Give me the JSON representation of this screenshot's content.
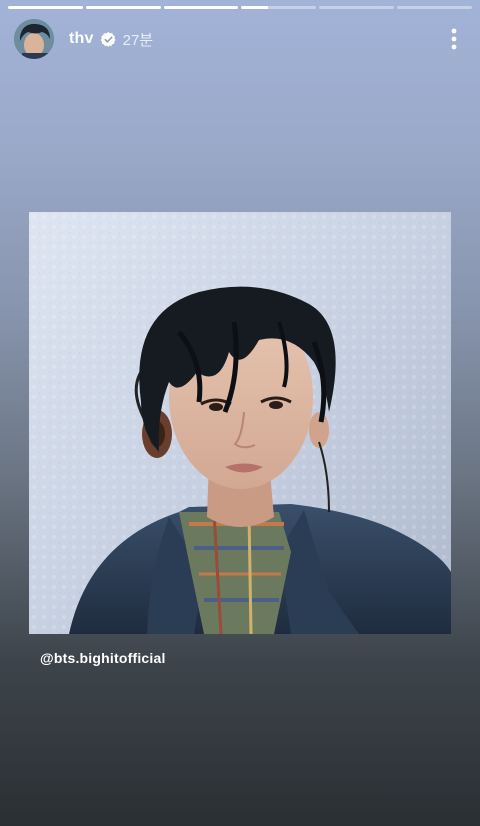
{
  "story": {
    "segment_count": 6,
    "active_segment": 4,
    "active_segment_progress": 0.35
  },
  "header": {
    "username": "thv",
    "verified": true,
    "time_ago": "27분",
    "menu_icon": "more-vertical-icon",
    "verified_icon": "verified-badge-icon"
  },
  "post": {
    "mention": "@bts.bighitofficial"
  },
  "colors": {
    "progress_filled": "#ffffff",
    "progress_empty": "rgba(255,255,255,0.4)",
    "background_top": "#a2b3d8",
    "background_bottom": "#2a2f33"
  }
}
